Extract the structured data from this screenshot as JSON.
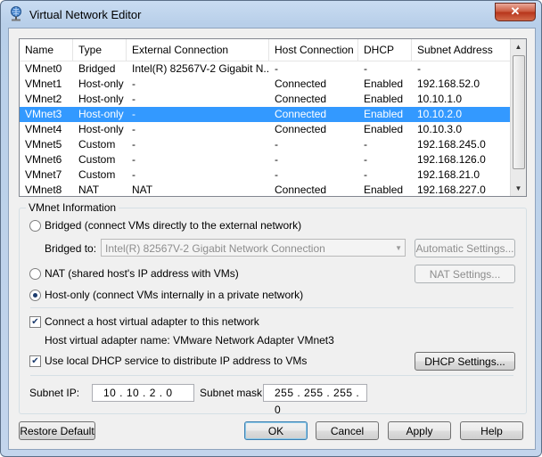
{
  "window": {
    "title": "Virtual Network Editor",
    "close_glyph": "✕"
  },
  "table": {
    "columns": [
      "Name",
      "Type",
      "External Connection",
      "Host Connection",
      "DHCP",
      "Subnet Address"
    ],
    "rows": [
      [
        "VMnet0",
        "Bridged",
        "Intel(R) 82567V-2 Gigabit N...",
        "-",
        "-",
        "-"
      ],
      [
        "VMnet1",
        "Host-only",
        "-",
        "Connected",
        "Enabled",
        "192.168.52.0"
      ],
      [
        "VMnet2",
        "Host-only",
        "-",
        "Connected",
        "Enabled",
        "10.10.1.0"
      ],
      [
        "VMnet3",
        "Host-only",
        "-",
        "Connected",
        "Enabled",
        "10.10.2.0"
      ],
      [
        "VMnet4",
        "Host-only",
        "-",
        "Connected",
        "Enabled",
        "10.10.3.0"
      ],
      [
        "VMnet5",
        "Custom",
        "-",
        "-",
        "-",
        "192.168.245.0"
      ],
      [
        "VMnet6",
        "Custom",
        "-",
        "-",
        "-",
        "192.168.126.0"
      ],
      [
        "VMnet7",
        "Custom",
        "-",
        "-",
        "-",
        "192.168.21.0"
      ],
      [
        "VMnet8",
        "NAT",
        "NAT",
        "Connected",
        "Enabled",
        "192.168.227.0"
      ]
    ],
    "selected_row": 3
  },
  "info": {
    "group_label": "VMnet Information",
    "bridged_label": "Bridged (connect VMs directly to the external network)",
    "bridged_to_label": "Bridged to:",
    "bridged_to_value": "Intel(R) 82567V-2 Gigabit Network Connection",
    "automatic_settings": "Automatic Settings...",
    "nat_label": "NAT (shared host's IP address with VMs)",
    "nat_settings": "NAT Settings...",
    "hostonly_label": "Host-only (connect VMs internally in a private network)",
    "connect_adapter_label": "Connect a host virtual adapter to this network",
    "adapter_name_text": "Host virtual adapter name: VMware Network Adapter VMnet3",
    "dhcp_label": "Use local DHCP service to distribute IP address to VMs",
    "dhcp_settings": "DHCP Settings...",
    "subnet_ip_label": "Subnet IP:",
    "subnet_ip_value": "10 . 10 . 2 . 0",
    "subnet_mask_label": "Subnet mask:",
    "subnet_mask_value": "255 . 255 . 255 . 0"
  },
  "buttons": {
    "restore": "Restore Default",
    "ok": "OK",
    "cancel": "Cancel",
    "apply": "Apply",
    "help": "Help"
  }
}
